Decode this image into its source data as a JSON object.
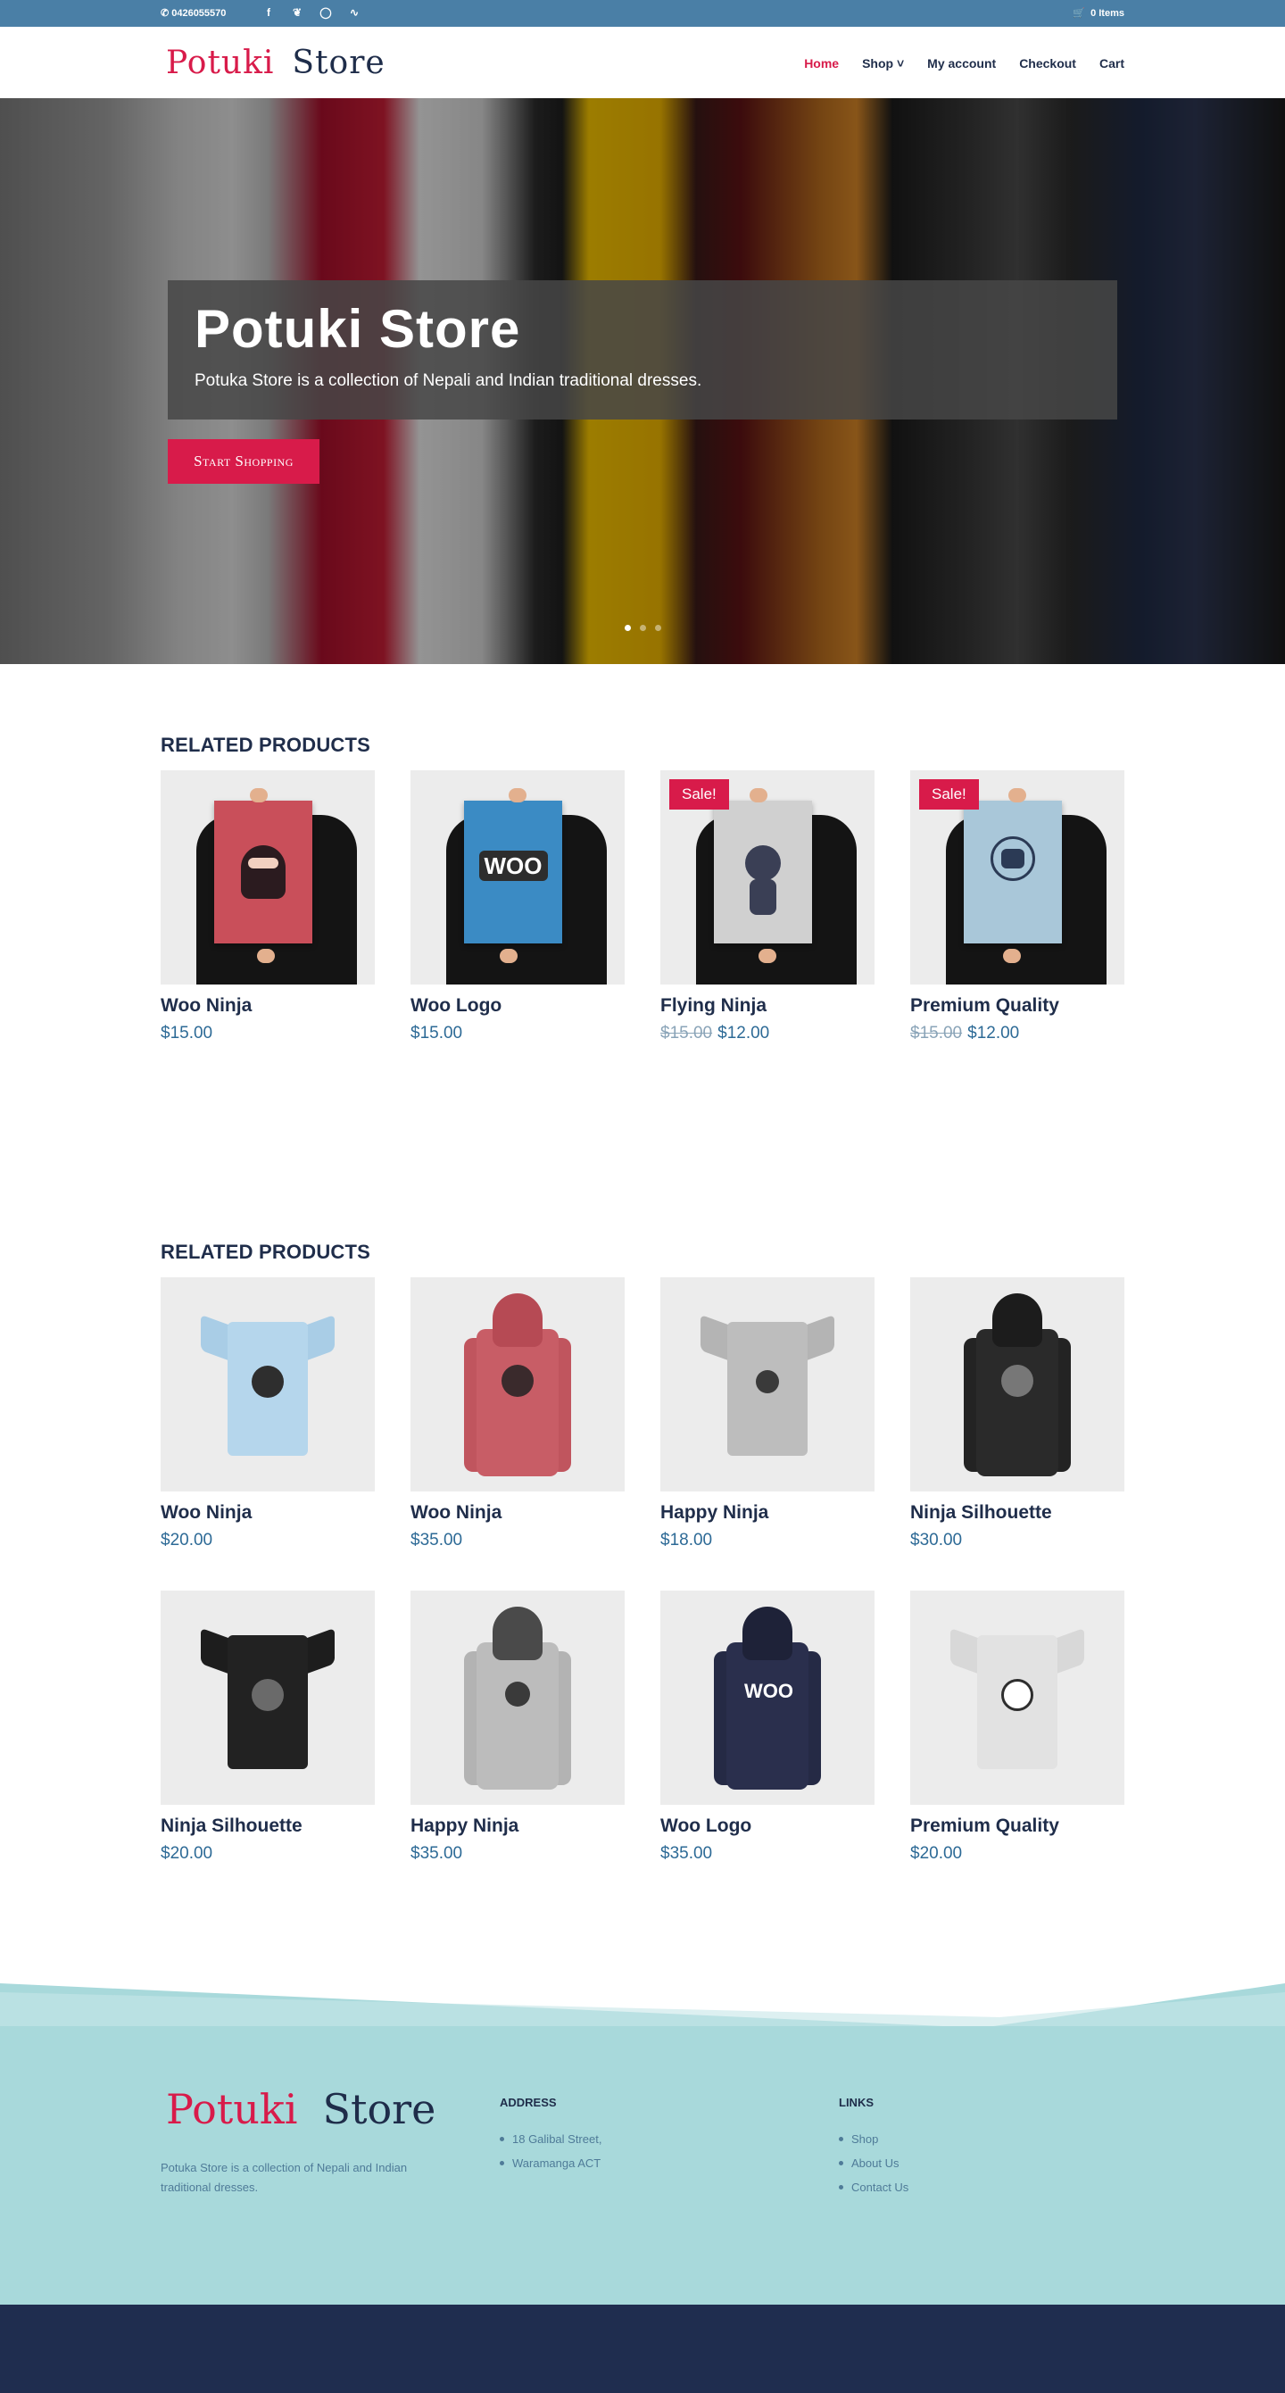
{
  "topbar": {
    "phone": "0426055570",
    "socials": [
      "facebook-icon",
      "twitter-icon",
      "instagram-icon",
      "rss-icon"
    ],
    "cart": "0 Items"
  },
  "header": {
    "logo_part1": "Potuki",
    "logo_part2": "Store",
    "nav": [
      "Home",
      "Shop",
      "My account",
      "Checkout",
      "Cart"
    ]
  },
  "hero": {
    "title": "Potuki Store",
    "subtitle": "Potuka Store is a collection of Nepali and Indian traditional dresses.",
    "button": "Start Shopping"
  },
  "section1": {
    "title": "RELATED PRODUCTS",
    "products": [
      {
        "name": "Woo Ninja",
        "price": "$15.00",
        "old_price": "",
        "sale": ""
      },
      {
        "name": "Woo Logo",
        "price": "$15.00",
        "old_price": "",
        "sale": ""
      },
      {
        "name": "Flying Ninja",
        "price": "$12.00",
        "old_price": "$15.00",
        "sale": "Sale!"
      },
      {
        "name": "Premium Quality",
        "price": "$12.00",
        "old_price": "$15.00",
        "sale": "Sale!"
      }
    ]
  },
  "section2": {
    "title": "RELATED PRODUCTS",
    "products": [
      {
        "name": "Woo Ninja",
        "price": "$20.00"
      },
      {
        "name": "Woo Ninja",
        "price": "$35.00"
      },
      {
        "name": "Happy Ninja",
        "price": "$18.00"
      },
      {
        "name": "Ninja Silhouette",
        "price": "$30.00"
      },
      {
        "name": "Ninja Silhouette",
        "price": "$20.00"
      },
      {
        "name": "Happy Ninja",
        "price": "$35.00"
      },
      {
        "name": "Woo Logo",
        "price": "$35.00"
      },
      {
        "name": "Premium Quality",
        "price": "$20.00"
      }
    ]
  },
  "footer": {
    "logo_part1": "Potuki",
    "logo_part2": "Store",
    "description": "Potuka Store is a collection of Nepali and Indian traditional dresses.",
    "address_title": "ADDRESS",
    "address": [
      "18 Galibal Street,",
      "Waramanga ACT"
    ],
    "links_title": "LINKS",
    "links": [
      "Shop",
      "About Us",
      "Contact Us"
    ]
  },
  "colors": {
    "topbar": "#4a7fa6",
    "accent": "#d81b4a",
    "navy": "#1f2d4a",
    "price": "#2d6a96",
    "footer": "#a8d9db"
  }
}
